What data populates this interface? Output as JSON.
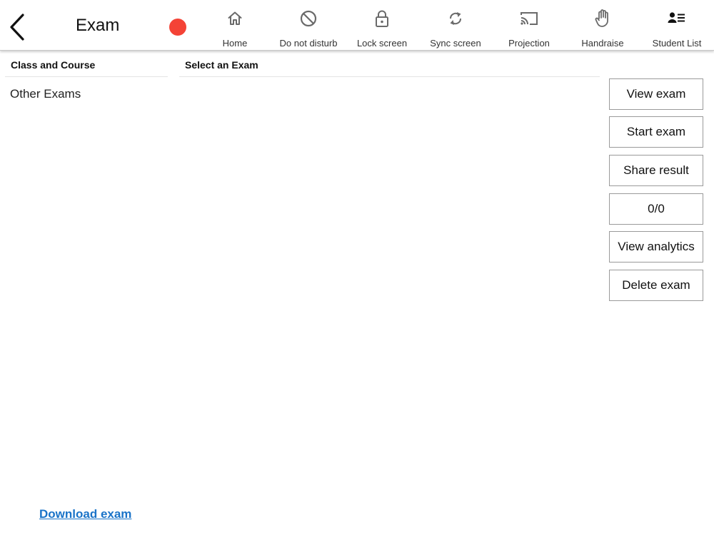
{
  "header": {
    "title": "Exam",
    "back_icon": "chevron-left-icon",
    "record_color": "#f44336"
  },
  "toolbar": [
    {
      "label": "Home",
      "icon": "home-icon"
    },
    {
      "label": "Do not disturb",
      "icon": "block-icon"
    },
    {
      "label": "Lock screen",
      "icon": "lock-icon"
    },
    {
      "label": "Sync screen",
      "icon": "sync-icon"
    },
    {
      "label": "Projection",
      "icon": "cast-icon"
    },
    {
      "label": "Handraise",
      "icon": "hand-icon"
    },
    {
      "label": "Student List",
      "icon": "student-list-icon"
    }
  ],
  "left_panel": {
    "header": "Class and Course",
    "items": [
      "Other Exams"
    ]
  },
  "middle_panel": {
    "header": "Select an Exam"
  },
  "actions": {
    "view_exam": "View exam",
    "start_exam": "Start exam",
    "share_result": "Share result",
    "counter": "0/0",
    "view_analytics": "View analytics",
    "delete_exam": "Delete exam"
  },
  "footer": {
    "download_link": "Download exam",
    "link_color": "#1a73c8"
  }
}
